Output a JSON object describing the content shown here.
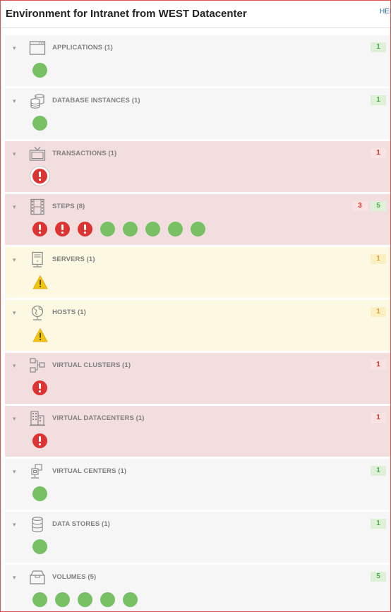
{
  "header": {
    "title": "Environment for Intranet from WEST Datacenter",
    "help_label": "HEL"
  },
  "colors": {
    "ok": "#77c063",
    "error": "#dd3333",
    "warning": "#f1c40f",
    "row_ok_bg": "#f6f6f6",
    "row_error_bg": "#f2dede",
    "row_warning_bg": "#fcf8e1"
  },
  "sections": [
    {
      "label": "APPLICATIONS (1)",
      "icon": "application-window-icon",
      "state": "green",
      "counts": [
        {
          "value": "1",
          "type": "green"
        }
      ],
      "items": [
        "ok"
      ]
    },
    {
      "label": "DATABASE INSTANCES (1)",
      "icon": "database-instances-icon",
      "state": "green",
      "counts": [
        {
          "value": "1",
          "type": "green"
        }
      ],
      "items": [
        "ok"
      ]
    },
    {
      "label": "TRANSACTIONS (1)",
      "icon": "tv-icon",
      "state": "red",
      "counts": [
        {
          "value": "1",
          "type": "red"
        }
      ],
      "items": [
        "err-boxed"
      ]
    },
    {
      "label": "STEPS (8)",
      "icon": "film-strip-icon",
      "state": "red",
      "counts": [
        {
          "value": "3",
          "type": "red"
        },
        {
          "value": "5",
          "type": "green"
        }
      ],
      "items": [
        "err",
        "err",
        "err",
        "ok",
        "ok",
        "ok",
        "ok",
        "ok"
      ]
    },
    {
      "label": "SERVERS (1)",
      "icon": "server-icon",
      "state": "yellow",
      "counts": [
        {
          "value": "1",
          "type": "yellow"
        }
      ],
      "items": [
        "warn"
      ]
    },
    {
      "label": "HOSTS (1)",
      "icon": "globe-icon",
      "state": "yellow",
      "counts": [
        {
          "value": "1",
          "type": "yellow"
        }
      ],
      "items": [
        "warn"
      ]
    },
    {
      "label": "VIRTUAL CLUSTERS (1)",
      "icon": "cluster-icon",
      "state": "red",
      "counts": [
        {
          "value": "1",
          "type": "red"
        }
      ],
      "items": [
        "err"
      ]
    },
    {
      "label": "VIRTUAL DATACENTERS (1)",
      "icon": "datacenter-building-icon",
      "state": "red",
      "counts": [
        {
          "value": "1",
          "type": "red"
        }
      ],
      "items": [
        "err"
      ]
    },
    {
      "label": "VIRTUAL CENTERS (1)",
      "icon": "network-node-icon",
      "state": "green",
      "counts": [
        {
          "value": "1",
          "type": "green"
        }
      ],
      "items": [
        "ok"
      ]
    },
    {
      "label": "DATA STORES (1)",
      "icon": "data-store-cylinder-icon",
      "state": "green",
      "counts": [
        {
          "value": "1",
          "type": "green"
        }
      ],
      "items": [
        "ok"
      ]
    },
    {
      "label": "VOLUMES (5)",
      "icon": "volume-box-icon",
      "state": "green",
      "counts": [
        {
          "value": "5",
          "type": "green"
        }
      ],
      "items": [
        "ok",
        "ok",
        "ok",
        "ok",
        "ok"
      ]
    }
  ]
}
